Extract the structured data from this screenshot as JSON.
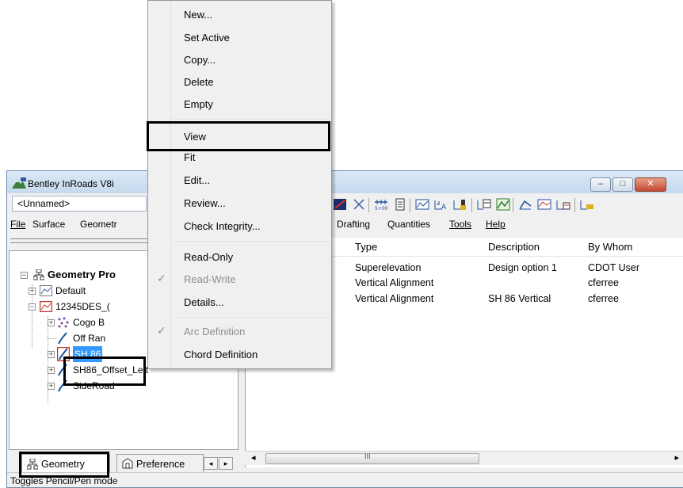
{
  "window": {
    "title": "Bentley InRoads V8i",
    "project": "<Unnamed>",
    "title_buttons": {
      "minimize": "–",
      "maximize": "□",
      "close": "✕"
    }
  },
  "menubar": [
    "File",
    "Surface",
    "Geometr",
    "Drafting",
    "Quantities",
    "Tools",
    "Help"
  ],
  "context_menu": {
    "items": [
      {
        "label": "New...",
        "disabled": false
      },
      {
        "label": "Set Active",
        "disabled": false
      },
      {
        "label": "Copy...",
        "disabled": false
      },
      {
        "label": "Delete",
        "disabled": false
      },
      {
        "label": "Empty",
        "disabled": false
      },
      {
        "label": "View",
        "disabled": false,
        "highlighted": true
      },
      {
        "label": "Fit",
        "disabled": false
      },
      {
        "label": "Edit...",
        "disabled": false
      },
      {
        "label": "Review...",
        "disabled": false
      },
      {
        "label": "Check Integrity...",
        "disabled": false
      },
      {
        "label": "Read-Only",
        "disabled": false
      },
      {
        "label": "Read-Write",
        "disabled": true,
        "checked": true
      },
      {
        "label": "Details...",
        "disabled": false
      },
      {
        "label": "Arc Definition",
        "disabled": true,
        "checked": true
      },
      {
        "label": "Chord Definition",
        "disabled": false
      }
    ],
    "check_glyph": "✓"
  },
  "tree": {
    "root": "Geometry Pro",
    "items": [
      "Default",
      "12345DES_(",
      "Cogo B",
      "Off Ran",
      "SH 86",
      "SH86_Offset_Left",
      "SideRoad"
    ],
    "selected": "SH 86"
  },
  "table": {
    "columns": [
      "Type",
      "Description",
      "By Whom"
    ],
    "rows": [
      [
        "Superelevation",
        "Design option 1",
        "CDOT User"
      ],
      [
        "Vertical Alignment",
        "",
        "cferree"
      ],
      [
        "Vertical Alignment",
        "SH 86 Vertical",
        "cferree"
      ]
    ]
  },
  "tabs": [
    "Geometry",
    "Preference"
  ],
  "scroll": {
    "left_arrow": "◂",
    "right_arrow": "▸",
    "thumb_grip": "III"
  },
  "status": "Toggles Pencil/Pen mode",
  "colors": {
    "selection": "#3399ff",
    "titlebar": "#c6d9ee"
  }
}
